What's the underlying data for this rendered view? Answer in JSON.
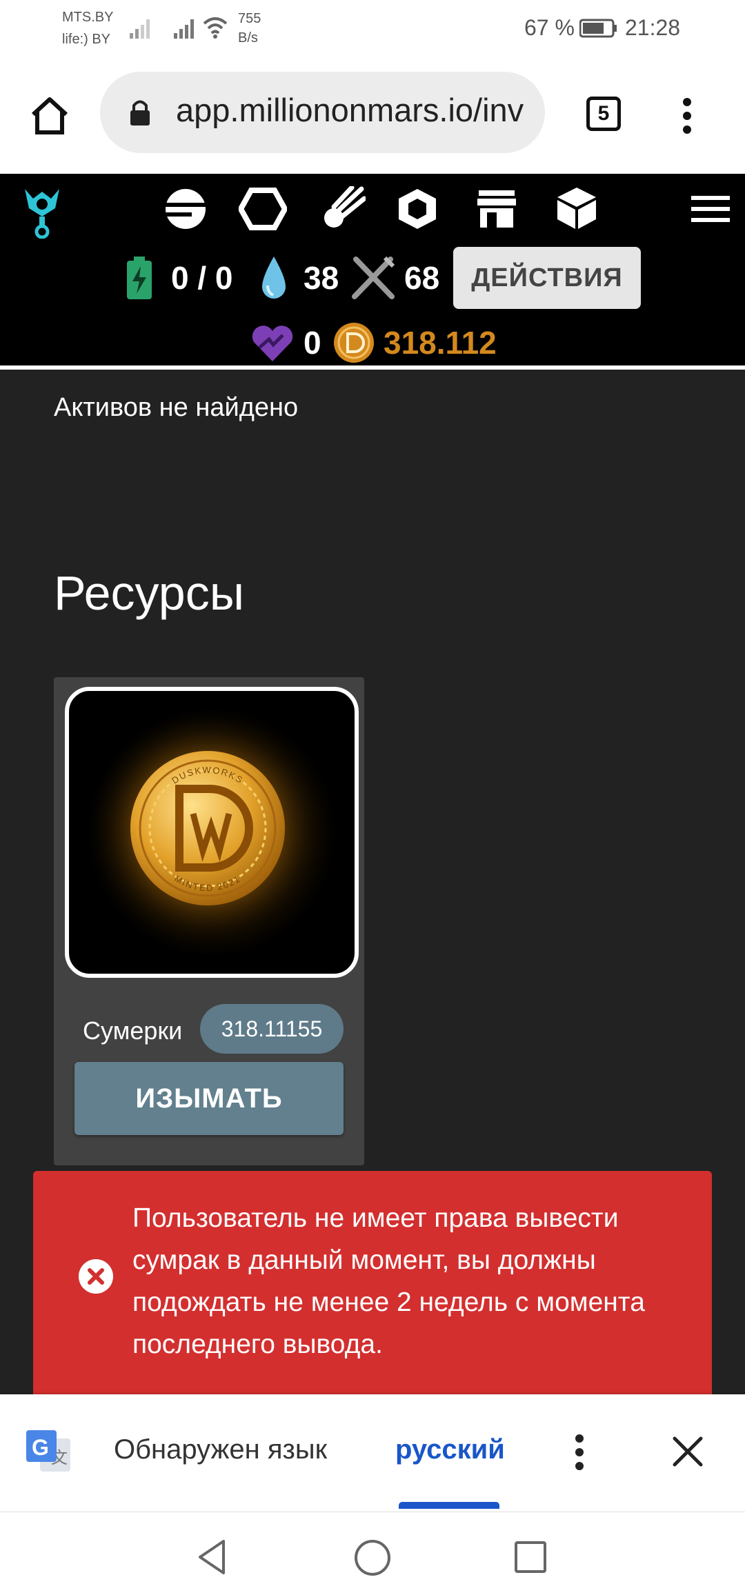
{
  "status_bar": {
    "carrier1": "MTS.BY",
    "carrier2": "life:) BY",
    "speed_value": "755",
    "speed_unit": "B/s",
    "battery": "67 %",
    "time": "21:28"
  },
  "browser": {
    "url": "app.milliononmars.io/inv",
    "tab_count": "5"
  },
  "app_header": {
    "energy": "0 / 0",
    "water": "38",
    "food": "68",
    "actions_label": "ДЕЙСТВИЯ",
    "health": "0",
    "dusk_balance": "318.112"
  },
  "content": {
    "no_assets": "Активов не найдено",
    "resources_title": "Ресурсы",
    "card": {
      "name": "Сумерки",
      "amount": "318.11155",
      "withdraw_label": "ИЗЫМАТЬ",
      "coin_ring_text_top": "DUSKWORKS",
      "coin_ring_text_bottom": "MINTED 2021"
    }
  },
  "toast": {
    "message": "Пользователь не имеет права вывести сумрак в данный момент, вы должны подождать не менее 2 недель с момента последнего вывода."
  },
  "translate_bar": {
    "detected_label": "Обнаружен язык",
    "language": "русский"
  },
  "colors": {
    "header_bg": "#000000",
    "page_bg": "#222222",
    "toast_bg": "#d32f2f",
    "dusk_gold": "#d4891e",
    "teal_logo": "#2ec4d6",
    "button_blue_gray": "#62808e"
  }
}
